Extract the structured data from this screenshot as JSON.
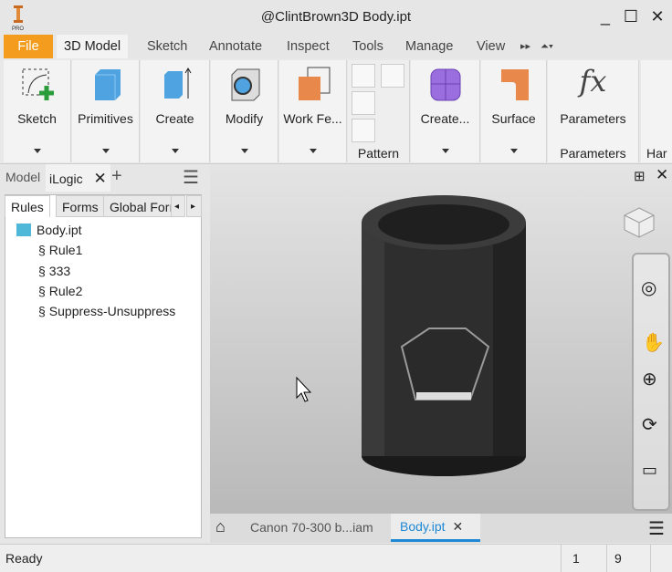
{
  "window": {
    "title": "@ClintBrown3D    Body.ipt",
    "logo_text": "PRO",
    "minimize": "_",
    "maximize": "☐",
    "close": "✕"
  },
  "menu_tabs": [
    "File",
    "3D Model",
    "Sketch",
    "Annotate",
    "Inspect",
    "Tools",
    "Manage",
    "View"
  ],
  "ribbon": {
    "panels": [
      "Sketch",
      "Primitives",
      "Create",
      "Modify",
      "Work Fe...",
      "Pattern",
      "Create...",
      "Surface",
      "Parameters",
      "Har"
    ],
    "parameters_group": "Parameters"
  },
  "left_panel": {
    "tabs": [
      "Model",
      "iLogic"
    ],
    "add": "+",
    "subtabs": [
      "Rules",
      "Forms",
      "Global Forı"
    ],
    "tree": {
      "root": "Body.ipt",
      "rules": [
        "Rule1",
        "333",
        "Rule2",
        "Suppress-Unsuppress"
      ]
    }
  },
  "doc_tabs": [
    "Canon 70-300 b...iam",
    "Body.ipt"
  ],
  "status": {
    "text": "Ready",
    "values": [
      "1",
      "9"
    ]
  },
  "colors": {
    "file": "#f39c1d",
    "active_tab": "#1e88d4"
  }
}
